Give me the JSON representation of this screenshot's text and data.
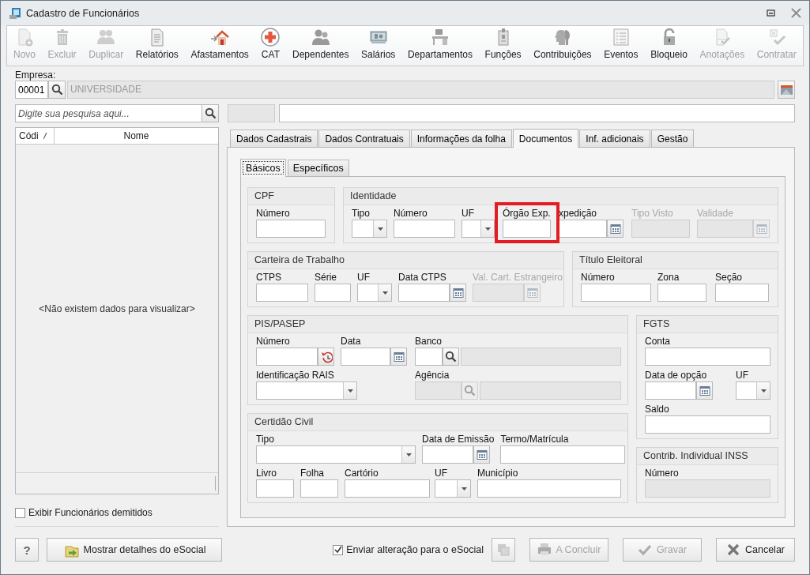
{
  "window": {
    "title": "Cadastro de Funcionários"
  },
  "toolbar": [
    {
      "label": "Novo",
      "disabled": true
    },
    {
      "label": "Excluir",
      "disabled": true
    },
    {
      "label": "Duplicar",
      "disabled": true
    },
    {
      "label": "Relatórios",
      "disabled": false
    },
    {
      "label": "Afastamentos",
      "disabled": false
    },
    {
      "label": "CAT",
      "disabled": false
    },
    {
      "label": "Dependentes",
      "disabled": false
    },
    {
      "label": "Salários",
      "disabled": false
    },
    {
      "label": "Departamentos",
      "disabled": false
    },
    {
      "label": "Funções",
      "disabled": false
    },
    {
      "label": "Contribuições",
      "disabled": false
    },
    {
      "label": "Eventos",
      "disabled": false
    },
    {
      "label": "Bloqueio",
      "disabled": false
    },
    {
      "label": "Anotações",
      "disabled": true
    },
    {
      "label": "Contratar",
      "disabled": true
    }
  ],
  "empresa": {
    "label": "Empresa:",
    "code": "00001",
    "name": "UNIVERSIDADE"
  },
  "search": {
    "placeholder": "Digite sua pesquisa aqui..."
  },
  "employee_list": {
    "columns": [
      "Códi",
      "Nome"
    ],
    "empty_message": "<Não existem dados para visualizar>"
  },
  "show_dismissed": {
    "label": "Exibir Funcionários demitidos",
    "checked": false
  },
  "tabs": [
    {
      "label": "Dados Cadastrais",
      "selected": false
    },
    {
      "label": "Dados Contratuais",
      "selected": false
    },
    {
      "label": "Informações da folha",
      "selected": false
    },
    {
      "label": "Documentos",
      "selected": true
    },
    {
      "label": "Inf. adicionais",
      "selected": false
    },
    {
      "label": "Gestão",
      "selected": false
    }
  ],
  "subtabs": [
    {
      "label": "Básicos",
      "selected": true
    },
    {
      "label": "Específicos",
      "selected": false
    }
  ],
  "groups": [
    {
      "title": "CPF",
      "fields": [
        {
          "label": "Número",
          "kind": "text",
          "disabled": false,
          "readonly": false
        }
      ]
    },
    {
      "title": "Identidade",
      "fields": [
        {
          "label": "Tipo",
          "kind": "combo",
          "disabled": false,
          "readonly": false
        },
        {
          "label": "Número",
          "kind": "text",
          "disabled": false,
          "readonly": false
        },
        {
          "label": "UF",
          "kind": "combo",
          "disabled": false,
          "readonly": false
        },
        {
          "label": "Órgão Exp.",
          "kind": "text",
          "disabled": false,
          "readonly": false,
          "highlighted": true
        },
        {
          "label": "xpedição",
          "kind": "date",
          "disabled": false,
          "readonly": false
        },
        {
          "label": "Tipo Visto",
          "kind": "text",
          "disabled": true,
          "readonly": true
        },
        {
          "label": "Validade",
          "kind": "date",
          "disabled": true,
          "readonly": true
        }
      ]
    },
    {
      "title": "Carteira de Trabalho",
      "fields": [
        {
          "label": "CTPS",
          "kind": "text",
          "disabled": false,
          "readonly": false
        },
        {
          "label": "Série",
          "kind": "text",
          "disabled": false,
          "readonly": false
        },
        {
          "label": "UF",
          "kind": "combo",
          "disabled": false,
          "readonly": false
        },
        {
          "label": "Data CTPS",
          "kind": "date",
          "disabled": false,
          "readonly": false
        },
        {
          "label": "Val. Cart. Estrangeiro",
          "kind": "date",
          "disabled": true,
          "readonly": true
        }
      ]
    },
    {
      "title": "Título Eleitoral",
      "fields": [
        {
          "label": "Número",
          "kind": "text",
          "disabled": false,
          "readonly": false
        },
        {
          "label": "Zona",
          "kind": "text",
          "disabled": false,
          "readonly": false
        },
        {
          "label": "Seção",
          "kind": "text",
          "disabled": false,
          "readonly": false
        }
      ]
    },
    {
      "title": "PIS/PASEP",
      "fields": [
        {
          "label": "Número",
          "kind": "history",
          "disabled": false,
          "readonly": false
        },
        {
          "label": "Data",
          "kind": "date",
          "disabled": false,
          "readonly": false
        },
        {
          "label": "Banco",
          "kind": "search",
          "disabled": false,
          "readonly": false
        },
        {
          "kind": "display",
          "readonly": true
        },
        {
          "label": "Identificação RAIS",
          "kind": "combo",
          "disabled": false,
          "readonly": false
        },
        {
          "label": "Agência",
          "kind": "search",
          "disabled": false,
          "readonly": true
        },
        {
          "kind": "display",
          "readonly": true
        }
      ]
    },
    {
      "title": "Certidão Civil",
      "fields": [
        {
          "label": "Tipo",
          "kind": "combo",
          "disabled": false,
          "readonly": false
        },
        {
          "label": "Data de Emissão",
          "kind": "date",
          "disabled": false,
          "readonly": false
        },
        {
          "label": "Termo/Matrícula",
          "kind": "text",
          "disabled": false,
          "readonly": false
        },
        {
          "label": "Livro",
          "kind": "text",
          "disabled": false,
          "readonly": false
        },
        {
          "label": "Folha",
          "kind": "text",
          "disabled": false,
          "readonly": false
        },
        {
          "label": "Cartório",
          "kind": "text",
          "disabled": false,
          "readonly": false
        },
        {
          "label": "UF",
          "kind": "combo",
          "disabled": false,
          "readonly": false
        },
        {
          "label": "Município",
          "kind": "text",
          "disabled": false,
          "readonly": false
        }
      ]
    },
    {
      "title": "FGTS",
      "fields": [
        {
          "label": "Conta",
          "kind": "text",
          "disabled": false,
          "readonly": false
        },
        {
          "label": "Data de opção",
          "kind": "date",
          "disabled": false,
          "readonly": false
        },
        {
          "label": "UF",
          "kind": "combo",
          "disabled": false,
          "readonly": false
        },
        {
          "label": "Saldo",
          "kind": "text",
          "disabled": false,
          "readonly": false
        }
      ]
    },
    {
      "title": "Contrib. Individual INSS",
      "fields": [
        {
          "label": "Número",
          "kind": "text",
          "disabled": false,
          "readonly": true
        }
      ]
    }
  ],
  "bottom": {
    "help": "?",
    "esocial_details": "Mostrar detalhes do eSocial",
    "send_esocial": {
      "label": "Enviar alteração para o eSocial",
      "checked": true
    },
    "buttons": [
      {
        "label": "A Concluir",
        "disabled": true
      },
      {
        "label": "Gravar",
        "disabled": true
      },
      {
        "label": "Cancelar",
        "disabled": false
      }
    ]
  }
}
